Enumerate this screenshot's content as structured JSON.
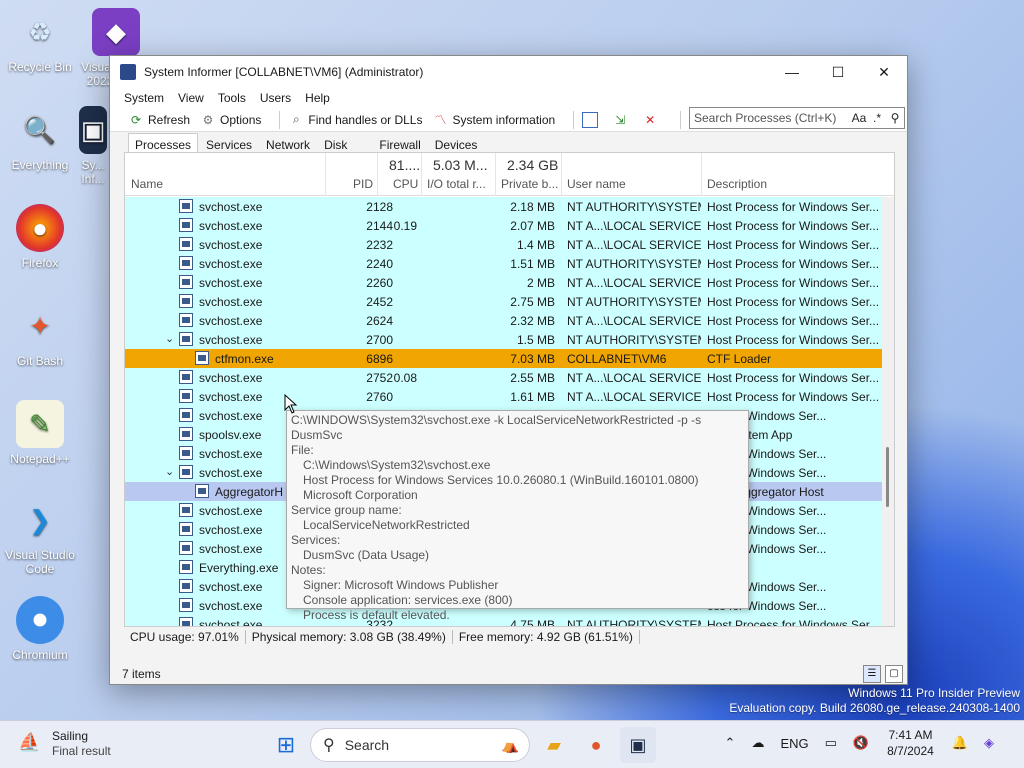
{
  "desktop": {
    "icons": [
      {
        "label": "Recycle Bin"
      },
      {
        "label": "Visual Studio 2022 Pre..."
      },
      {
        "label": "Everything"
      },
      {
        "label": "Sy... Inf..."
      },
      {
        "label": "Firefox"
      },
      {
        "label": "Git Bash"
      },
      {
        "label": "Notepad++"
      },
      {
        "label": "Visual Studio Code"
      },
      {
        "label": "Chromium"
      }
    ],
    "watermark_line1": "Windows 11 Pro Insider Preview",
    "watermark_line2": "Evaluation copy. Build 26080.ge_release.240308-1400"
  },
  "window": {
    "title": "System Informer [COLLABNET\\VM6] (Administrator)",
    "controls": {
      "minimize": "—",
      "maximize": "☐",
      "close": "✕"
    },
    "menu": [
      "System",
      "View",
      "Tools",
      "Users",
      "Help"
    ],
    "toolbar": {
      "refresh": "Refresh",
      "options": "Options",
      "find_handles": "Find handles or DLLs",
      "system_information": "System information"
    },
    "search_placeholder": "Search Processes (Ctrl+K)",
    "search_opts": "Aa",
    "search_regex": ".*",
    "tabs": [
      "Processes",
      "Services",
      "Network",
      "Disk",
      "Firewall",
      "Devices"
    ],
    "active_tab": "Processes",
    "columns": {
      "name": "Name",
      "pid": "PID",
      "cpu": "CPU",
      "io": "I/O total r...",
      "private": "Private b...",
      "user": "User name",
      "description": "Description"
    },
    "summaries": {
      "cpu": "81....",
      "io": "5.03 M...",
      "private": "2.34 GB"
    },
    "rows": [
      {
        "name": "svchost.exe",
        "pid": "2128",
        "cpu": "",
        "private": "2.18 MB",
        "user": "NT AUTHORITY\\SYSTEM",
        "desc": "Host Process for Windows Ser...",
        "indent": 1,
        "style": "cyan",
        "chev": ""
      },
      {
        "name": "svchost.exe",
        "pid": "2144",
        "cpu": "0.19",
        "private": "2.07 MB",
        "user": "NT A...\\LOCAL SERVICE",
        "desc": "Host Process for Windows Ser...",
        "indent": 1,
        "style": "cyan",
        "chev": ""
      },
      {
        "name": "svchost.exe",
        "pid": "2232",
        "cpu": "",
        "private": "1.4 MB",
        "user": "NT A...\\LOCAL SERVICE",
        "desc": "Host Process for Windows Ser...",
        "indent": 1,
        "style": "cyan",
        "chev": ""
      },
      {
        "name": "svchost.exe",
        "pid": "2240",
        "cpu": "",
        "private": "1.51 MB",
        "user": "NT AUTHORITY\\SYSTEM",
        "desc": "Host Process for Windows Ser...",
        "indent": 1,
        "style": "cyan",
        "chev": ""
      },
      {
        "name": "svchost.exe",
        "pid": "2260",
        "cpu": "",
        "private": "2 MB",
        "user": "NT A...\\LOCAL SERVICE",
        "desc": "Host Process for Windows Ser...",
        "indent": 1,
        "style": "cyan",
        "chev": ""
      },
      {
        "name": "svchost.exe",
        "pid": "2452",
        "cpu": "",
        "private": "2.75 MB",
        "user": "NT AUTHORITY\\SYSTEM",
        "desc": "Host Process for Windows Ser...",
        "indent": 1,
        "style": "cyan",
        "chev": ""
      },
      {
        "name": "svchost.exe",
        "pid": "2624",
        "cpu": "",
        "private": "2.32 MB",
        "user": "NT A...\\LOCAL SERVICE",
        "desc": "Host Process for Windows Ser...",
        "indent": 1,
        "style": "cyan",
        "chev": ""
      },
      {
        "name": "svchost.exe",
        "pid": "2700",
        "cpu": "",
        "private": "1.5 MB",
        "user": "NT AUTHORITY\\SYSTEM",
        "desc": "Host Process for Windows Ser...",
        "indent": 1,
        "style": "cyan",
        "chev": "⌄"
      },
      {
        "name": "ctfmon.exe",
        "pid": "6896",
        "cpu": "",
        "private": "7.03 MB",
        "user": "COLLABNET\\VM6",
        "desc": "CTF Loader",
        "indent": 2,
        "style": "orange",
        "chev": ""
      },
      {
        "name": "svchost.exe",
        "pid": "2752",
        "cpu": "0.08",
        "private": "2.55 MB",
        "user": "NT A...\\LOCAL SERVICE",
        "desc": "Host Process for Windows Ser...",
        "indent": 1,
        "style": "cyan",
        "chev": ""
      },
      {
        "name": "svchost.exe",
        "pid": "2760",
        "cpu": "",
        "private": "1.61 MB",
        "user": "NT A...\\LOCAL SERVICE",
        "desc": "Host Process for Windows Ser...",
        "indent": 1,
        "style": "cyan",
        "chev": ""
      },
      {
        "name": "svchost.exe",
        "pid": "",
        "cpu": "",
        "private": "",
        "user": "",
        "desc": "ess for Windows Ser...",
        "indent": 1,
        "style": "cyan",
        "chev": ""
      },
      {
        "name": "spoolsv.exe",
        "pid": "",
        "cpu": "",
        "private": "",
        "user": "",
        "desc": "SubSystem App",
        "indent": 1,
        "style": "cyan",
        "chev": ""
      },
      {
        "name": "svchost.exe",
        "pid": "",
        "cpu": "",
        "private": "",
        "user": "",
        "desc": "ess for Windows Ser...",
        "indent": 1,
        "style": "cyan",
        "chev": ""
      },
      {
        "name": "svchost.exe",
        "pid": "",
        "cpu": "",
        "private": "",
        "user": "",
        "desc": "ess for Windows Ser...",
        "indent": 1,
        "style": "cyan",
        "chev": "⌄"
      },
      {
        "name": "AggregatorH",
        "pid": "",
        "cpu": "",
        "private": "",
        "user": "",
        "desc": "ft (R) Aggregator Host",
        "indent": 2,
        "style": "blue",
        "chev": ""
      },
      {
        "name": "svchost.exe",
        "pid": "",
        "cpu": "",
        "private": "",
        "user": "",
        "desc": "ess for Windows Ser...",
        "indent": 1,
        "style": "cyan",
        "chev": ""
      },
      {
        "name": "svchost.exe",
        "pid": "",
        "cpu": "",
        "private": "",
        "user": "",
        "desc": "ess for Windows Ser...",
        "indent": 1,
        "style": "cyan",
        "chev": ""
      },
      {
        "name": "svchost.exe",
        "pid": "",
        "cpu": "",
        "private": "",
        "user": "",
        "desc": "ess for Windows Ser...",
        "indent": 1,
        "style": "cyan",
        "chev": ""
      },
      {
        "name": "Everything.exe",
        "pid": "",
        "cpu": "",
        "private": "",
        "user": "",
        "desc": "ing",
        "indent": 1,
        "style": "cyan",
        "chev": ""
      },
      {
        "name": "svchost.exe",
        "pid": "",
        "cpu": "",
        "private": "",
        "user": "",
        "desc": "ess for Windows Ser...",
        "indent": 1,
        "style": "cyan",
        "chev": ""
      },
      {
        "name": "svchost.exe",
        "pid": "",
        "cpu": "",
        "private": "",
        "user": "",
        "desc": "ess for Windows Ser...",
        "indent": 1,
        "style": "cyan",
        "chev": ""
      },
      {
        "name": "svchost.exe",
        "pid": "3232",
        "cpu": "",
        "private": "4.75 MB",
        "user": "NT AUTHORITY\\SYSTEM",
        "desc": "Host Process for Windows Ser...",
        "indent": 1,
        "style": "cyan",
        "chev": ""
      }
    ],
    "status": {
      "cpu": "CPU usage: 97.01%",
      "physical": "Physical memory: 3.08 GB (38.49%)",
      "free": "Free memory: 4.92 GB (61.51%)"
    },
    "items_count": "7 items"
  },
  "tooltip": {
    "line1": "C:\\WINDOWS\\System32\\svchost.exe -k LocalServiceNetworkRestricted -p -s DusmSvc",
    "file_label": "File:",
    "file_path": "C:\\Windows\\System32\\svchost.exe",
    "file_desc": "Host Process for Windows Services 10.0.26080.1 (WinBuild.160101.0800)",
    "file_company": "Microsoft Corporation",
    "group_label": "Service group name:",
    "group_value": "LocalServiceNetworkRestricted",
    "services_label": "Services:",
    "services_value": "DusmSvc (Data Usage)",
    "notes_label": "Notes:",
    "note1": "Signer: Microsoft Windows Publisher",
    "note2": "Console application: services.exe (800)",
    "note3": "Process is default elevated."
  },
  "taskbar": {
    "weather_title": "Sailing",
    "weather_sub": "Final result",
    "search_label": "Search",
    "language": "ENG",
    "time": "7:41 AM",
    "date": "8/7/2024"
  }
}
